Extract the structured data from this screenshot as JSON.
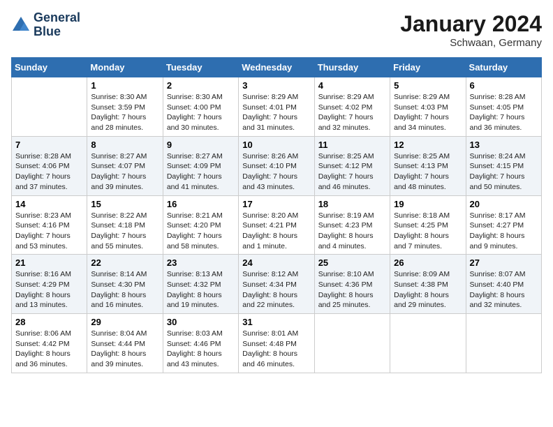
{
  "header": {
    "logo_line1": "General",
    "logo_line2": "Blue",
    "month_title": "January 2024",
    "location": "Schwaan, Germany"
  },
  "days_of_week": [
    "Sunday",
    "Monday",
    "Tuesday",
    "Wednesday",
    "Thursday",
    "Friday",
    "Saturday"
  ],
  "weeks": [
    [
      {
        "num": "",
        "info": ""
      },
      {
        "num": "1",
        "info": "Sunrise: 8:30 AM\nSunset: 3:59 PM\nDaylight: 7 hours\nand 28 minutes."
      },
      {
        "num": "2",
        "info": "Sunrise: 8:30 AM\nSunset: 4:00 PM\nDaylight: 7 hours\nand 30 minutes."
      },
      {
        "num": "3",
        "info": "Sunrise: 8:29 AM\nSunset: 4:01 PM\nDaylight: 7 hours\nand 31 minutes."
      },
      {
        "num": "4",
        "info": "Sunrise: 8:29 AM\nSunset: 4:02 PM\nDaylight: 7 hours\nand 32 minutes."
      },
      {
        "num": "5",
        "info": "Sunrise: 8:29 AM\nSunset: 4:03 PM\nDaylight: 7 hours\nand 34 minutes."
      },
      {
        "num": "6",
        "info": "Sunrise: 8:28 AM\nSunset: 4:05 PM\nDaylight: 7 hours\nand 36 minutes."
      }
    ],
    [
      {
        "num": "7",
        "info": "Sunrise: 8:28 AM\nSunset: 4:06 PM\nDaylight: 7 hours\nand 37 minutes."
      },
      {
        "num": "8",
        "info": "Sunrise: 8:27 AM\nSunset: 4:07 PM\nDaylight: 7 hours\nand 39 minutes."
      },
      {
        "num": "9",
        "info": "Sunrise: 8:27 AM\nSunset: 4:09 PM\nDaylight: 7 hours\nand 41 minutes."
      },
      {
        "num": "10",
        "info": "Sunrise: 8:26 AM\nSunset: 4:10 PM\nDaylight: 7 hours\nand 43 minutes."
      },
      {
        "num": "11",
        "info": "Sunrise: 8:25 AM\nSunset: 4:12 PM\nDaylight: 7 hours\nand 46 minutes."
      },
      {
        "num": "12",
        "info": "Sunrise: 8:25 AM\nSunset: 4:13 PM\nDaylight: 7 hours\nand 48 minutes."
      },
      {
        "num": "13",
        "info": "Sunrise: 8:24 AM\nSunset: 4:15 PM\nDaylight: 7 hours\nand 50 minutes."
      }
    ],
    [
      {
        "num": "14",
        "info": "Sunrise: 8:23 AM\nSunset: 4:16 PM\nDaylight: 7 hours\nand 53 minutes."
      },
      {
        "num": "15",
        "info": "Sunrise: 8:22 AM\nSunset: 4:18 PM\nDaylight: 7 hours\nand 55 minutes."
      },
      {
        "num": "16",
        "info": "Sunrise: 8:21 AM\nSunset: 4:20 PM\nDaylight: 7 hours\nand 58 minutes."
      },
      {
        "num": "17",
        "info": "Sunrise: 8:20 AM\nSunset: 4:21 PM\nDaylight: 8 hours\nand 1 minute."
      },
      {
        "num": "18",
        "info": "Sunrise: 8:19 AM\nSunset: 4:23 PM\nDaylight: 8 hours\nand 4 minutes."
      },
      {
        "num": "19",
        "info": "Sunrise: 8:18 AM\nSunset: 4:25 PM\nDaylight: 8 hours\nand 7 minutes."
      },
      {
        "num": "20",
        "info": "Sunrise: 8:17 AM\nSunset: 4:27 PM\nDaylight: 8 hours\nand 9 minutes."
      }
    ],
    [
      {
        "num": "21",
        "info": "Sunrise: 8:16 AM\nSunset: 4:29 PM\nDaylight: 8 hours\nand 13 minutes."
      },
      {
        "num": "22",
        "info": "Sunrise: 8:14 AM\nSunset: 4:30 PM\nDaylight: 8 hours\nand 16 minutes."
      },
      {
        "num": "23",
        "info": "Sunrise: 8:13 AM\nSunset: 4:32 PM\nDaylight: 8 hours\nand 19 minutes."
      },
      {
        "num": "24",
        "info": "Sunrise: 8:12 AM\nSunset: 4:34 PM\nDaylight: 8 hours\nand 22 minutes."
      },
      {
        "num": "25",
        "info": "Sunrise: 8:10 AM\nSunset: 4:36 PM\nDaylight: 8 hours\nand 25 minutes."
      },
      {
        "num": "26",
        "info": "Sunrise: 8:09 AM\nSunset: 4:38 PM\nDaylight: 8 hours\nand 29 minutes."
      },
      {
        "num": "27",
        "info": "Sunrise: 8:07 AM\nSunset: 4:40 PM\nDaylight: 8 hours\nand 32 minutes."
      }
    ],
    [
      {
        "num": "28",
        "info": "Sunrise: 8:06 AM\nSunset: 4:42 PM\nDaylight: 8 hours\nand 36 minutes."
      },
      {
        "num": "29",
        "info": "Sunrise: 8:04 AM\nSunset: 4:44 PM\nDaylight: 8 hours\nand 39 minutes."
      },
      {
        "num": "30",
        "info": "Sunrise: 8:03 AM\nSunset: 4:46 PM\nDaylight: 8 hours\nand 43 minutes."
      },
      {
        "num": "31",
        "info": "Sunrise: 8:01 AM\nSunset: 4:48 PM\nDaylight: 8 hours\nand 46 minutes."
      },
      {
        "num": "",
        "info": ""
      },
      {
        "num": "",
        "info": ""
      },
      {
        "num": "",
        "info": ""
      }
    ]
  ]
}
